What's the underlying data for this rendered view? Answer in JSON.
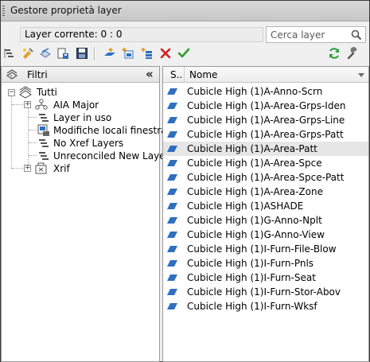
{
  "window": {
    "title": "Gestore proprietà layer"
  },
  "current_layer": {
    "text": "Layer corrente: 0 : 0"
  },
  "search": {
    "placeholder": "Cerca layer"
  },
  "toolbar": {
    "left_icons": [
      "new-property-filter-icon",
      "new-group-filter-icon",
      "layer-states-icon",
      "save-layer-state-icon",
      "save-icon",
      "new-layer-icon",
      "new-layer-vp-frozen-icon",
      "new-layer-vp-icon",
      "delete-layer-icon",
      "set-current-icon"
    ],
    "right_icons": [
      "refresh-icon",
      "settings-icon"
    ]
  },
  "filters": {
    "header": "Filtri",
    "tree": [
      {
        "label": "Tutti",
        "icon": "layer-stack-icon"
      },
      {
        "label": "AIA Major",
        "icon": "group-filter-icon"
      },
      {
        "label": "Layer in uso",
        "icon": "property-filter-icon"
      },
      {
        "label": "Modifiche locali finestra",
        "icon": "viewport-override-icon"
      },
      {
        "label": "No Xref Layers",
        "icon": "property-filter-icon"
      },
      {
        "label": "Unreconciled New Layers",
        "icon": "property-filter-icon"
      },
      {
        "label": "Xrif",
        "icon": "xref-filter-icon"
      }
    ]
  },
  "layer_list": {
    "columns": {
      "status": "S..",
      "name": "Nome"
    },
    "rows": [
      "Cubicle High (1)A-Anno-Scrn",
      "Cubicle High (1)A-Area-Grps-Iden",
      "Cubicle High (1)A-Area-Grps-Line",
      "Cubicle High (1)A-Area-Grps-Patt",
      "Cubicle High (1)A-Area-Patt",
      "Cubicle High (1)A-Area-Spce",
      "Cubicle High (1)A-Area-Spce-Patt",
      "Cubicle High (1)A-Area-Zone",
      "Cubicle High (1)ASHADE",
      "Cubicle High (1)G-Anno-Nplt",
      "Cubicle High (1)G-Anno-View",
      "Cubicle High (1)I-Furn-File-Blow",
      "Cubicle High (1)I-Furn-Pnls",
      "Cubicle High (1)I-Furn-Seat",
      "Cubicle High (1)I-Furn-Stor-Abov",
      "Cubicle High (1)I-Furn-Wksf"
    ],
    "selected_index": 4
  },
  "colors": {
    "layer_icon": "#2f6fc0",
    "selected_row": "#e6e6e6",
    "delete_red": "#d42020",
    "check_green": "#2e9a2e",
    "refresh_green": "#2b9b3a"
  }
}
